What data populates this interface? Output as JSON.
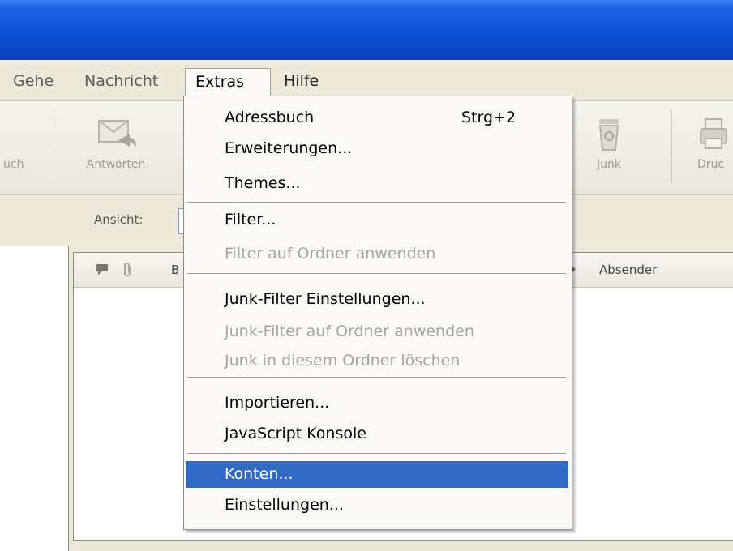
{
  "menubar": {
    "items": [
      {
        "label": "Gehe"
      },
      {
        "label": "Nachricht"
      },
      {
        "label": "Extras"
      },
      {
        "label": "Hilfe"
      }
    ]
  },
  "toolbar": {
    "buttons": [
      {
        "label": "uch",
        "icon": "address-book-icon"
      },
      {
        "label": "Antworten",
        "icon": "reply-icon"
      },
      {
        "label": "Junk",
        "icon": "junk-icon"
      },
      {
        "label": "Druc",
        "icon": "print-icon"
      }
    ]
  },
  "filterbar": {
    "view_label": "Ansicht:"
  },
  "threadpane": {
    "columns": [
      {
        "label": "B"
      },
      {
        "label": "Absender"
      }
    ]
  },
  "dropdown": {
    "items": [
      {
        "label": "Adressbuch",
        "shortcut": "Strg+2",
        "enabled": true
      },
      {
        "label": "Erweiterungen...",
        "enabled": true
      },
      {
        "label": "Themes...",
        "enabled": true
      },
      {
        "label": "Filter...",
        "enabled": true
      },
      {
        "label": "Filter auf Ordner anwenden",
        "enabled": false
      },
      {
        "label": "Junk-Filter Einstellungen...",
        "enabled": true
      },
      {
        "label": "Junk-Filter auf Ordner anwenden",
        "enabled": false
      },
      {
        "label": "Junk in diesem Ordner löschen",
        "enabled": false
      },
      {
        "label": "Importieren...",
        "enabled": true
      },
      {
        "label": "JavaScript Konsole",
        "enabled": true
      },
      {
        "label": "Konten...",
        "enabled": true,
        "highlighted": true
      },
      {
        "label": "Einstellungen...",
        "enabled": true
      }
    ]
  },
  "colors": {
    "titlebar": "#0a4fd6",
    "menu_highlight": "#316ac5",
    "disabled_text": "#a7a598",
    "chrome": "#ece9d8"
  }
}
